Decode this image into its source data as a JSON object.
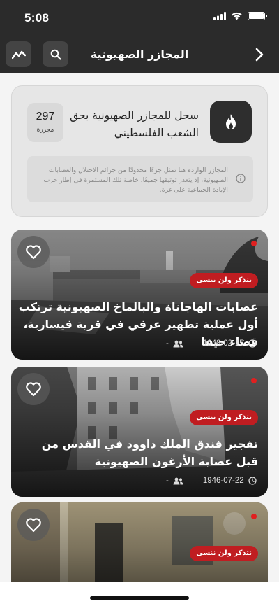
{
  "status_bar": {
    "time": "5:08"
  },
  "header": {
    "title": "المجازر الصهيونية"
  },
  "info_card": {
    "title": "سجل للمجازر الصهيونية بحق الشعب الفلسطيني",
    "count": "297",
    "count_label": "مجزرة",
    "note": "المجازر الواردة هنا تمثل جزءًا محدودًا من جرائم الاحتلال والعصابات الصهيونية، إذ يتعذر توثيقها جميعًا، خاصة تلك المستمرة في إطار حرب الإبادة الجماعية على غزة."
  },
  "posts": [
    {
      "tag": "نتذكر ولن ننسى",
      "title": "عصابات الهاجاناة والبالماخ الصهيونية ترتكب أول عملية تطهير عرقي في قرية قيسارية، قضاء حيفا",
      "date": "1948-02-15",
      "casualties": "-"
    },
    {
      "tag": "نتذكر ولن ننسى",
      "title": "تفجير فندق الملك داوود في القدس من قبل عصابة الأرغون الصهيونية",
      "date": "1946-07-22",
      "casualties": "-"
    },
    {
      "tag": "نتذكر ولن ننسى",
      "title": "",
      "date": "",
      "casualties": ""
    }
  ],
  "icons": {
    "chart": "trend-chart-icon",
    "search": "search-icon",
    "back": "chevron-right-icon",
    "flame": "flame-icon",
    "info": "info-icon",
    "heart": "heart-outline-icon",
    "people": "people-icon",
    "clock": "clock-icon"
  },
  "colors": {
    "header_bg": "#2b2b2b",
    "tag_red": "#c01d21",
    "dot_red": "#e02020"
  }
}
